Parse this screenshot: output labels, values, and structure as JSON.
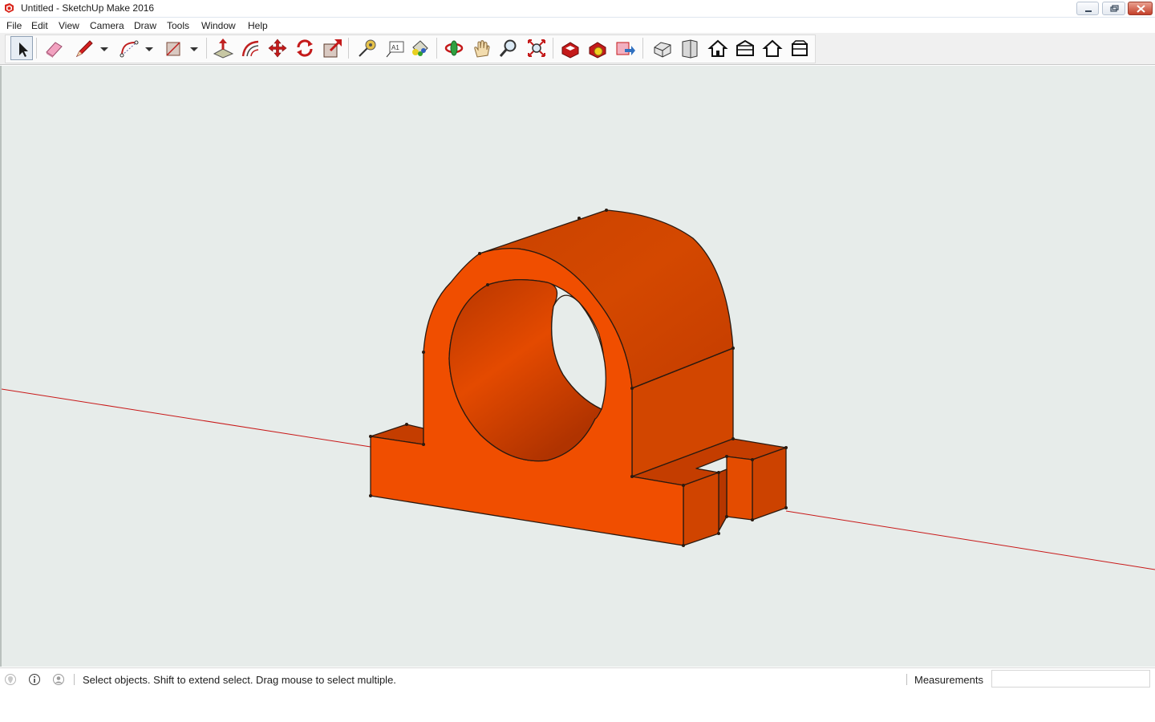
{
  "window": {
    "title": "Untitled - SketchUp Make 2016",
    "app_icon": "sketchup-icon",
    "controls": [
      "minimize-icon",
      "maximize-icon",
      "close-icon"
    ]
  },
  "menu": {
    "items": [
      "File",
      "Edit",
      "View",
      "Camera",
      "Draw",
      "Tools",
      "Window",
      "Help"
    ]
  },
  "toolbar": {
    "tools": [
      {
        "name": "select",
        "icon": "arrow-cursor-icon",
        "active": true
      },
      {
        "name": "eraser",
        "icon": "eraser-icon"
      },
      {
        "name": "line",
        "icon": "pencil-icon",
        "dropdown": true
      },
      {
        "name": "arc",
        "icon": "arc-icon",
        "dropdown": true
      },
      {
        "name": "rectangle",
        "icon": "rectangle-icon",
        "dropdown": true
      },
      {
        "name": "push-pull",
        "icon": "push-pull-icon"
      },
      {
        "name": "offset",
        "icon": "offset-icon"
      },
      {
        "name": "move",
        "icon": "move-icon"
      },
      {
        "name": "rotate",
        "icon": "rotate-icon"
      },
      {
        "name": "scale",
        "icon": "scale-icon"
      },
      {
        "name": "tape-measure",
        "icon": "tape-measure-icon"
      },
      {
        "name": "text",
        "icon": "text-icon"
      },
      {
        "name": "paint-bucket",
        "icon": "paint-bucket-icon"
      },
      {
        "name": "orbit",
        "icon": "orbit-icon"
      },
      {
        "name": "pan",
        "icon": "pan-hand-icon"
      },
      {
        "name": "zoom",
        "icon": "zoom-icon"
      },
      {
        "name": "zoom-extents",
        "icon": "zoom-extents-icon"
      },
      {
        "name": "3d-warehouse",
        "icon": "warehouse-icon"
      },
      {
        "name": "extension-warehouse",
        "icon": "extension-warehouse-icon"
      },
      {
        "name": "share-model",
        "icon": "share-model-icon"
      },
      {
        "name": "iso-view",
        "icon": "iso-view-icon"
      },
      {
        "name": "top-view",
        "icon": "top-view-icon"
      },
      {
        "name": "front-view",
        "icon": "front-view-icon"
      },
      {
        "name": "right-view",
        "icon": "right-view-icon"
      },
      {
        "name": "back-view",
        "icon": "back-view-icon"
      },
      {
        "name": "left-view",
        "icon": "left-view-icon"
      }
    ]
  },
  "viewport": {
    "background_color": "#e7ecea",
    "model_color": "#f04e00",
    "model_shade_color": "#c43d00",
    "axis_color": "#c81818",
    "model": "pillow-block-bearing"
  },
  "status": {
    "icons": [
      "geo-location-icon",
      "info-icon",
      "user-icon"
    ],
    "message": "Select objects. Shift to extend select. Drag mouse to select multiple.",
    "measurements_label": "Measurements",
    "measurements_value": ""
  }
}
